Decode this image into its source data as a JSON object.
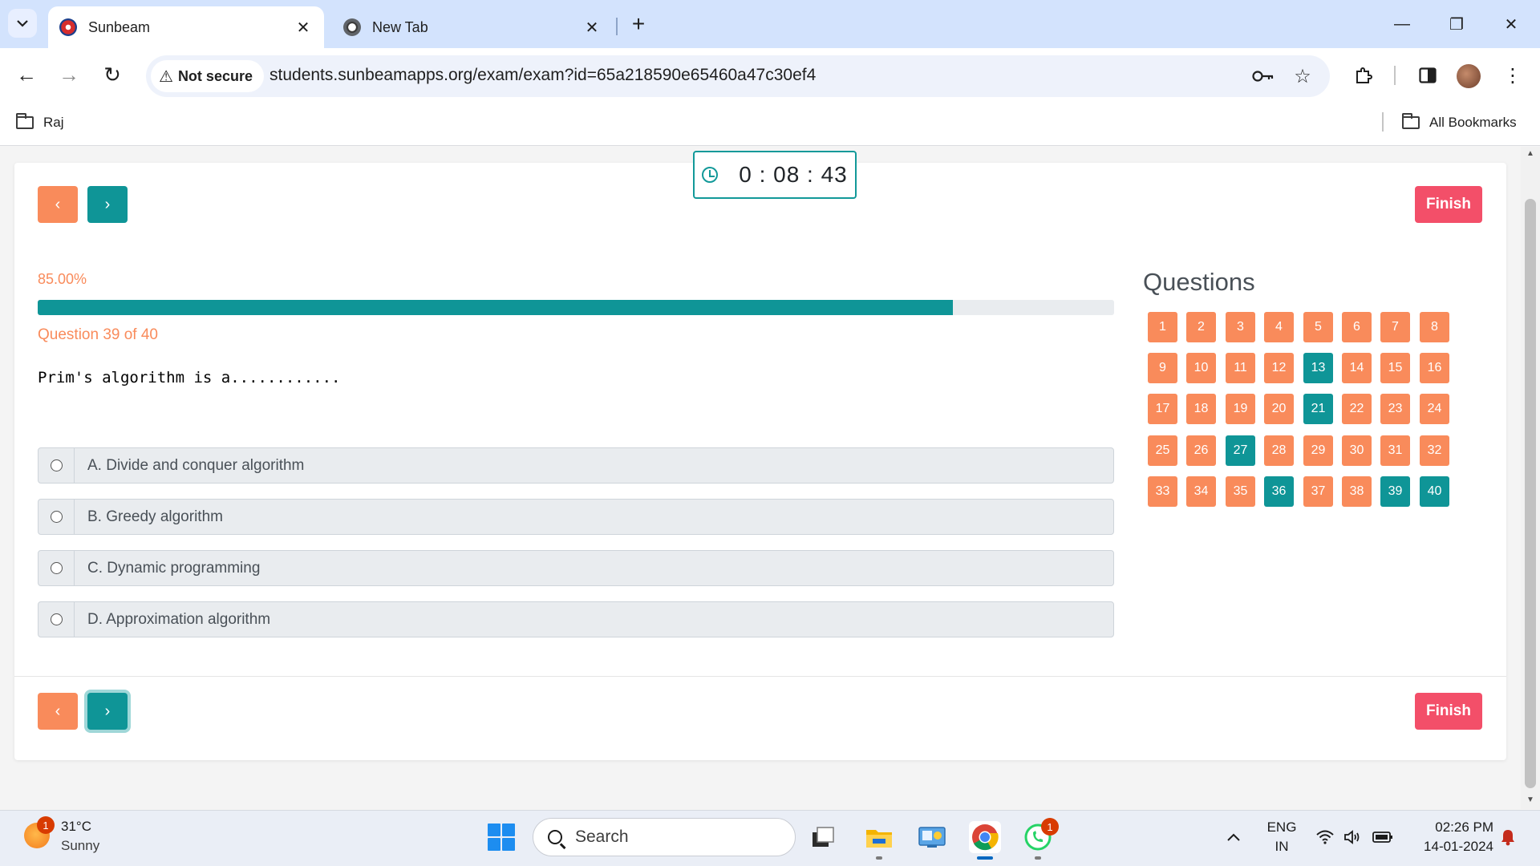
{
  "browser": {
    "tabs": [
      {
        "title": "Sunbeam",
        "favicon": "sunbeam-logo-icon",
        "active": true
      },
      {
        "title": "New Tab",
        "favicon": "chrome-icon",
        "active": false
      }
    ],
    "new_tab_label": "+",
    "security_label": "Not secure",
    "url": "students.sunbeamapps.org/exam/exam?id=65a218590e65460a47c30ef4",
    "bookmarks": [
      {
        "label": "Raj",
        "icon": "folder-icon"
      }
    ],
    "all_bookmarks_label": "All Bookmarks"
  },
  "exam": {
    "timer": {
      "display": "0 : 08 : 43"
    },
    "progress": {
      "percent_text": "85.00%",
      "percent_value": 85
    },
    "question_counter": "Question 39 of 40",
    "question_text": "Prim's algorithm is a............",
    "options": [
      {
        "label": "A. Divide and conquer algorithm",
        "selected": false
      },
      {
        "label": "B. Greedy algorithm",
        "selected": false
      },
      {
        "label": "C. Dynamic programming",
        "selected": false
      },
      {
        "label": "D. Approximation algorithm",
        "selected": false
      }
    ],
    "nav": {
      "prev_symbol": "‹",
      "next_symbol": "›",
      "finish_label": "Finish"
    },
    "questions_panel": {
      "heading": "Questions",
      "answered": [
        13,
        21,
        27,
        36,
        39,
        40
      ],
      "total": 40
    },
    "colors": {
      "accent_teal": "#0f9597",
      "accent_orange": "#f98b5b",
      "finish_red": "#f34f69"
    }
  },
  "taskbar": {
    "weather": {
      "temp": "31°C",
      "desc": "Sunny",
      "badge": "1"
    },
    "search_placeholder": "Search",
    "whatsapp_badge": "1",
    "language": {
      "line1": "ENG",
      "line2": "IN"
    },
    "clock": {
      "time": "02:26 PM",
      "date": "14-01-2024"
    }
  }
}
